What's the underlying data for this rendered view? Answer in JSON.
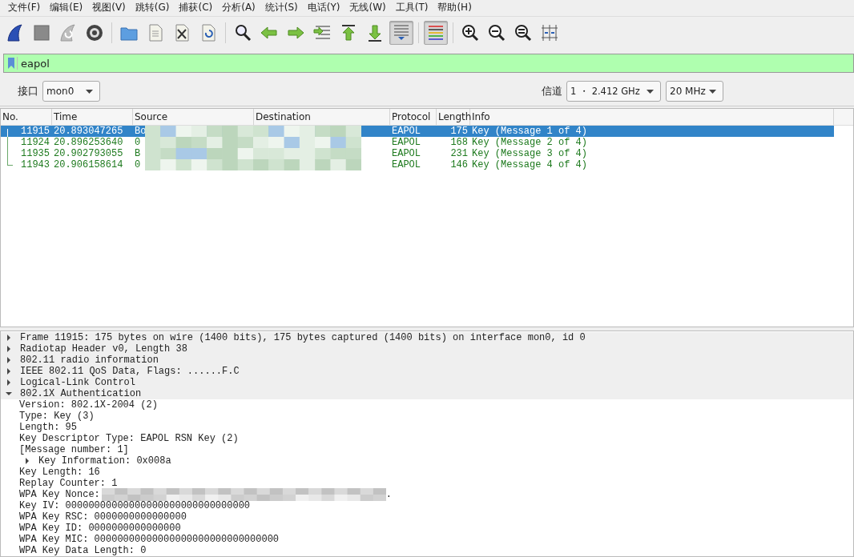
{
  "menu": [
    "文件(F)",
    "编辑(E)",
    "视图(V)",
    "跳转(G)",
    "捕获(C)",
    "分析(A)",
    "统计(S)",
    "电话(Y)",
    "无线(W)",
    "工具(T)",
    "帮助(H)"
  ],
  "toolbar": [
    [
      {
        "kind": "start",
        "pressed": false
      },
      {
        "kind": "stop",
        "pressed": false
      },
      {
        "kind": "restart",
        "pressed": false
      },
      {
        "kind": "options",
        "pressed": false
      }
    ],
    [
      {
        "kind": "open",
        "pressed": false
      },
      {
        "kind": "file",
        "pressed": false
      },
      {
        "kind": "close",
        "pressed": false
      },
      {
        "kind": "reload",
        "pressed": false
      }
    ],
    [
      {
        "kind": "find",
        "pressed": false
      },
      {
        "kind": "back",
        "pressed": false
      },
      {
        "kind": "forward",
        "pressed": false
      },
      {
        "kind": "goto",
        "pressed": false
      },
      {
        "kind": "first",
        "pressed": false
      },
      {
        "kind": "last",
        "pressed": false
      },
      {
        "kind": "autoscroll",
        "pressed": true
      }
    ],
    [
      {
        "kind": "colorize",
        "pressed": true
      }
    ],
    [
      {
        "kind": "zoomin",
        "pressed": false
      },
      {
        "kind": "zoomout",
        "pressed": false
      },
      {
        "kind": "zoomnormal",
        "pressed": false
      },
      {
        "kind": "resize",
        "pressed": false
      }
    ]
  ],
  "filter": {
    "value": "eapol",
    "valid": true
  },
  "interface_bar": {
    "interface_label": "接口",
    "interface": "mon0",
    "channel_label": "信道",
    "channel": "1 ・ 2.412 GHz",
    "width": "20 MHz"
  },
  "packet_list": {
    "columns": [
      "No.",
      "Time",
      "Source",
      "Destination",
      "Protocol",
      "Length",
      "Info"
    ],
    "rows": [
      {
        "no": "11915",
        "time": "20.893047265",
        "source": "Bo",
        "protocol": "EAPOL",
        "length": "175",
        "info": "Key (Message 1 of 4)",
        "selected": true
      },
      {
        "no": "11924",
        "time": "20.896253640",
        "source": "0",
        "protocol": "EAPOL",
        "length": "168",
        "info": "Key (Message 2 of 4)",
        "selected": false
      },
      {
        "no": "11935",
        "time": "20.902793055",
        "source": "B",
        "protocol": "EAPOL",
        "length": "231",
        "info": "Key (Message 3 of 4)",
        "selected": false
      },
      {
        "no": "11943",
        "time": "20.906158614",
        "source": "0",
        "protocol": "EAPOL",
        "length": "146",
        "info": "Key (Message 4 of 4)",
        "selected": false
      }
    ]
  },
  "details": [
    {
      "text": "Frame 11915: 175 bytes on wire (1400 bits), 175 bytes captured (1400 bits) on interface mon0, id 0",
      "expanded": false
    },
    {
      "text": "Radiotap Header v0, Length 38",
      "expanded": false
    },
    {
      "text": "802.11 radio information",
      "expanded": false
    },
    {
      "text": "IEEE 802.11 QoS Data, Flags: ......F.C",
      "expanded": false
    },
    {
      "text": "Logical-Link Control",
      "expanded": false
    },
    {
      "text": "802.1X Authentication",
      "expanded": true,
      "children": [
        {
          "text": "Version: 802.1X-2004 (2)"
        },
        {
          "text": "Type: Key (3)"
        },
        {
          "text": "Length: 95"
        },
        {
          "text": "Key Descriptor Type: EAPOL RSN Key (2)"
        },
        {
          "text": "[Message number: 1]"
        },
        {
          "text": "Key Information: 0x008a",
          "expanded": false
        },
        {
          "text": "Key Length: 16"
        },
        {
          "text": "Replay Counter: 1"
        },
        {
          "text": "WPA Key Nonce:",
          "kind": "redacted",
          "tail": "."
        },
        {
          "text": "Key IV: 00000000000000000000000000000000"
        },
        {
          "text": "WPA Key RSC: 0000000000000000"
        },
        {
          "text": "WPA Key ID: 0000000000000000"
        },
        {
          "text": "WPA Key MIC: 00000000000000000000000000000000"
        },
        {
          "text": "WPA Key Data Length: 0"
        }
      ]
    }
  ]
}
